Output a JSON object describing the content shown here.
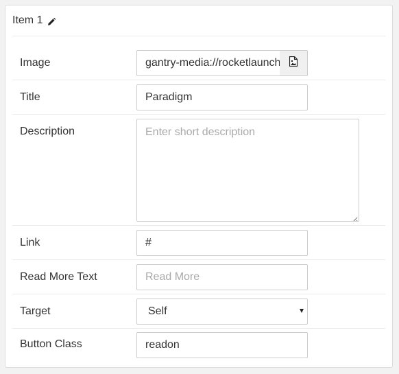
{
  "header": {
    "title": "Item 1",
    "edit_icon": "pencil-icon"
  },
  "fields": {
    "image": {
      "label": "Image",
      "value": "gantry-media://rocketlaunch",
      "picker_icon": "image-file-icon"
    },
    "title": {
      "label": "Title",
      "value": "Paradigm"
    },
    "description": {
      "label": "Description",
      "placeholder": "Enter short description",
      "value": ""
    },
    "link": {
      "label": "Link",
      "value": "#"
    },
    "read_more": {
      "label": "Read More Text",
      "placeholder": "Read More",
      "value": ""
    },
    "target": {
      "label": "Target",
      "selected": "Self"
    },
    "button_class": {
      "label": "Button Class",
      "value": "readon"
    }
  }
}
